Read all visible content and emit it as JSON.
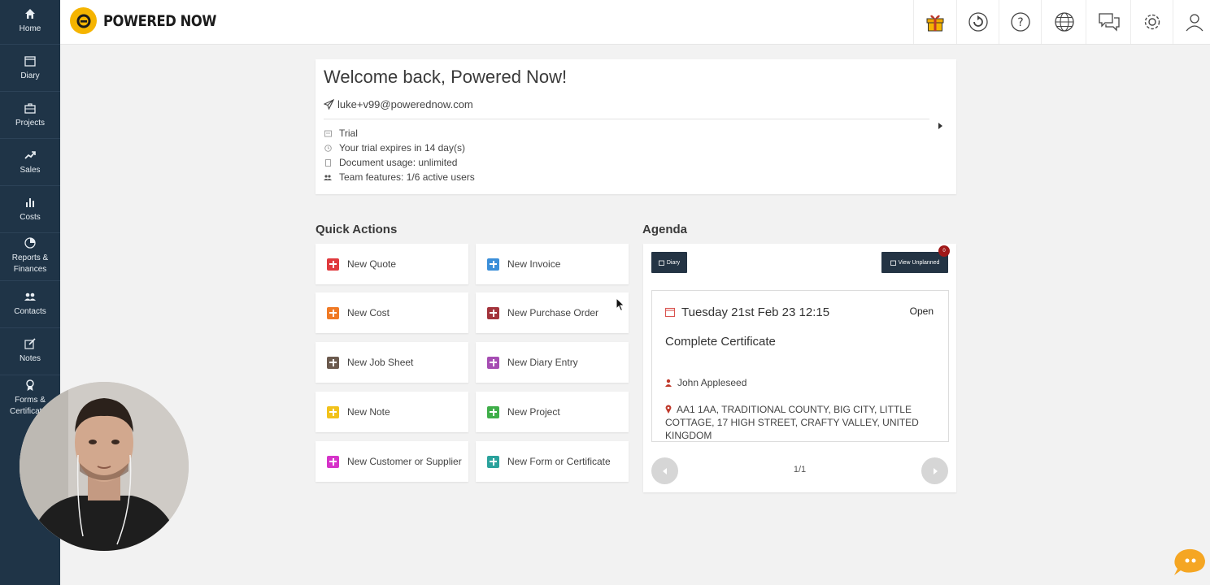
{
  "sidebar": {
    "items": [
      {
        "label": "Home",
        "icon": "home-icon"
      },
      {
        "label": "Diary",
        "icon": "calendar-icon"
      },
      {
        "label": "Projects",
        "icon": "briefcase-icon"
      },
      {
        "label": "Sales",
        "icon": "trend-up-icon"
      },
      {
        "label": "Costs",
        "icon": "bar-chart-icon"
      },
      {
        "label": "Reports &",
        "label2": "Finances",
        "icon": "pie-chart-icon"
      },
      {
        "label": "Contacts",
        "icon": "users-icon"
      },
      {
        "label": "Notes",
        "icon": "edit-icon"
      },
      {
        "label": "Forms &",
        "label2": "Certificates",
        "icon": "certificate-icon"
      }
    ]
  },
  "topbar": {
    "brand": "POWERED NOW",
    "icons": [
      "gift-icon",
      "refresh-icon",
      "help-icon",
      "globe-icon",
      "chat-icon",
      "settings-icon",
      "user-icon"
    ]
  },
  "welcome": {
    "title": "Welcome back, Powered Now!",
    "email": "luke+v99@powerednow.com",
    "rows": [
      "Trial",
      "Your trial expires in 14 day(s)",
      "Document usage: unlimited",
      "Team features: 1/6 active users"
    ]
  },
  "quick_actions": {
    "title": "Quick Actions",
    "items": [
      {
        "label": "New Quote",
        "color": "#e03a3e"
      },
      {
        "label": "New Invoice",
        "color": "#3b8fd9"
      },
      {
        "label": "New Cost",
        "color": "#f07a25"
      },
      {
        "label": "New Purchase Order",
        "color": "#a3333b"
      },
      {
        "label": "New Job Sheet",
        "color": "#6b5a4e"
      },
      {
        "label": "New Diary Entry",
        "color": "#a64db3"
      },
      {
        "label": "New Note",
        "color": "#f2c21b"
      },
      {
        "label": "New Project",
        "color": "#3fae49"
      },
      {
        "label": "New Customer or Supplier",
        "color": "#d633c9"
      },
      {
        "label": "New Form or Certificate",
        "color": "#2aa29c"
      }
    ]
  },
  "agenda": {
    "title": "Agenda",
    "diary_button": "Diary",
    "unplanned_button": "View Unplanned",
    "unplanned_count": "0",
    "event": {
      "date": "Tuesday 21st Feb 23 12:15",
      "status": "Open",
      "title": "Complete Certificate",
      "person": "John Appleseed",
      "address": "AA1 1AA, TRADITIONAL COUNTY, BIG CITY, LITTLE COTTAGE, 17 HIGH STREET, CRAFTY VALLEY, UNITED KINGDOM"
    },
    "pager": "1/1"
  },
  "colors": {
    "sidebar_bg": "#1f3447",
    "brand_yellow": "#f5b400",
    "accent_red": "#c0392b"
  }
}
